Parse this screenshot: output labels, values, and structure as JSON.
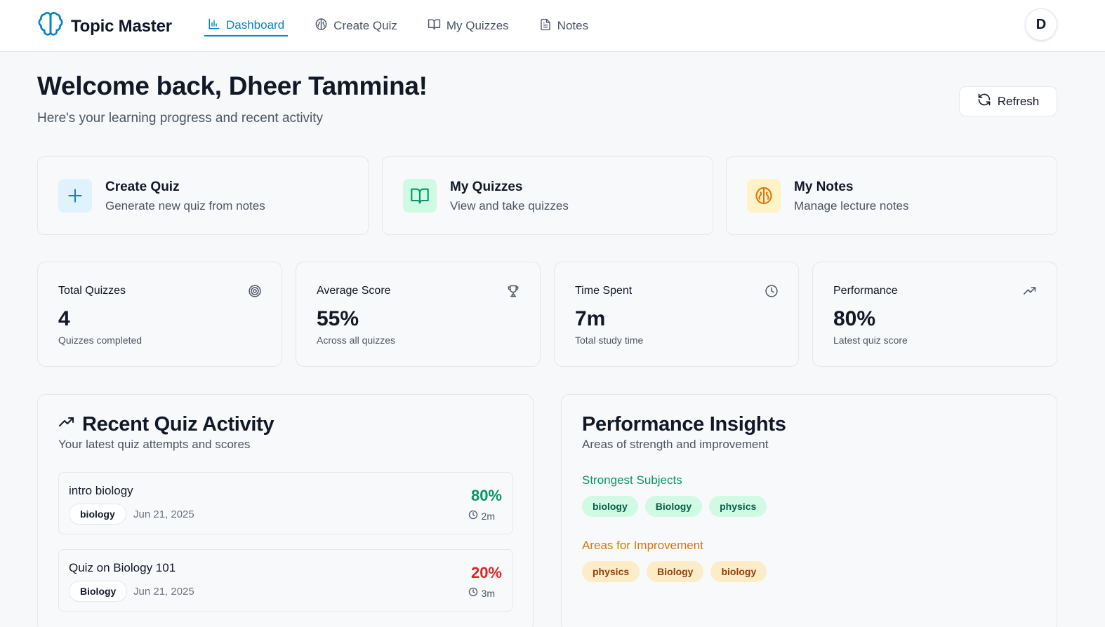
{
  "app": {
    "name": "Topic Master"
  },
  "nav": [
    {
      "label": "Dashboard",
      "icon": "bar-chart-icon",
      "active": true
    },
    {
      "label": "Create Quiz",
      "icon": "brain-icon",
      "active": false
    },
    {
      "label": "My Quizzes",
      "icon": "book-open-icon",
      "active": false
    },
    {
      "label": "Notes",
      "icon": "file-text-icon",
      "active": false
    }
  ],
  "user": {
    "initial": "D"
  },
  "header": {
    "title": "Welcome back, Dheer Tammina!",
    "subtitle": "Here's your learning progress and recent activity",
    "refresh_label": "Refresh"
  },
  "actions": [
    {
      "title": "Create Quiz",
      "description": "Generate new quiz from notes",
      "icon": "plus-icon",
      "color": "#0284c7",
      "bg": "#e0f2fe"
    },
    {
      "title": "My Quizzes",
      "description": "View and take quizzes",
      "icon": "book-open-icon",
      "color": "#059669",
      "bg": "#d1fae5"
    },
    {
      "title": "My Notes",
      "description": "Manage lecture notes",
      "icon": "brain-icon",
      "color": "#d97706",
      "bg": "#fef3c7"
    }
  ],
  "stats": [
    {
      "label": "Total Quizzes",
      "value": "4",
      "note": "Quizzes completed",
      "icon": "target-icon"
    },
    {
      "label": "Average Score",
      "value": "55%",
      "note": "Across all quizzes",
      "icon": "trophy-icon"
    },
    {
      "label": "Time Spent",
      "value": "7m",
      "note": "Total study time",
      "icon": "clock-icon"
    },
    {
      "label": "Performance",
      "value": "80%",
      "note": "Latest quiz score",
      "icon": "trending-up-icon"
    }
  ],
  "recent": {
    "title": "Recent Quiz Activity",
    "subtitle": "Your latest quiz attempts and scores",
    "items": [
      {
        "name": "intro biology",
        "tag": "biology",
        "date": "Jun 21, 2025",
        "score": "80%",
        "time": "2m",
        "score_color": "#059669"
      },
      {
        "name": "Quiz on Biology 101",
        "tag": "Biology",
        "date": "Jun 21, 2025",
        "score": "20%",
        "time": "3m",
        "score_color": "#dc2626"
      }
    ]
  },
  "insights": {
    "title": "Performance Insights",
    "subtitle": "Areas of strength and improvement",
    "strong_heading": "Strongest Subjects",
    "strong_color": "#059669",
    "strong": [
      "biology",
      "Biology",
      "physics"
    ],
    "weak_heading": "Areas for Improvement",
    "weak_color": "#d97706",
    "weak": [
      "physics",
      "Biology",
      "biology"
    ]
  }
}
